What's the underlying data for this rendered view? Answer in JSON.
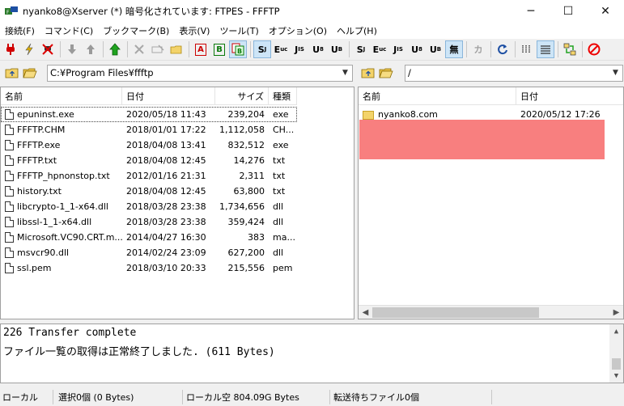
{
  "window": {
    "title": "nyanko8@Xserver (*) 暗号化されています: FTPES - FFFTP",
    "minimize": "─",
    "maximize": "☐",
    "close": "✕"
  },
  "menu": [
    {
      "label": "接続(F)"
    },
    {
      "label": "コマンド(C)"
    },
    {
      "label": "ブックマーク(B)"
    },
    {
      "label": "表示(V)"
    },
    {
      "label": "ツール(T)"
    },
    {
      "label": "オプション(O)"
    },
    {
      "label": "ヘルプ(H)"
    }
  ],
  "toolbar": {
    "connect_icon": "plug-connect-icon",
    "quick_connect_icon": "lightning-icon",
    "disconnect_icon": "plug-disconnect-icon",
    "download_icon": "arrow-down-icon",
    "upload_icon": "arrow-up-icon",
    "mirror_upload_icon": "green-up-arrow-icon",
    "delete_icon": "x-icon",
    "rename_icon": "rename-icon",
    "mkdir_icon": "new-folder-icon",
    "ascii_label": "A",
    "binary_label": "B",
    "auto_label": "",
    "kanji_sjis": "S",
    "kanji_euc": "E",
    "kanji_jis": "J",
    "kanji_utf8": "U",
    "kanji_utf8bom": "U",
    "kanji_none": "無",
    "kana_label": "カ",
    "refresh_icon": "refresh-icon",
    "list_icon": "list-view-icon",
    "details_icon": "details-view-icon",
    "sync_icon": "sync-folders-icon",
    "stop_icon": "stop-icon"
  },
  "local": {
    "path": "C:¥Program Files¥ffftp",
    "columns": [
      "名前",
      "日付",
      "サイズ",
      "種類"
    ],
    "files": [
      {
        "name": "epuninst.exe",
        "date": "2020/05/18 11:43",
        "size": "239,204",
        "type": "exe"
      },
      {
        "name": "FFFTP.CHM",
        "date": "2018/01/01 17:22",
        "size": "1,112,058",
        "type": "CH..."
      },
      {
        "name": "FFFTP.exe",
        "date": "2018/04/08 13:41",
        "size": "832,512",
        "type": "exe"
      },
      {
        "name": "FFFTP.txt",
        "date": "2018/04/08 12:45",
        "size": "14,276",
        "type": "txt"
      },
      {
        "name": "FFFTP_hpnonstop.txt",
        "date": "2012/01/16 21:31",
        "size": "2,311",
        "type": "txt"
      },
      {
        "name": "history.txt",
        "date": "2018/04/08 12:45",
        "size": "63,800",
        "type": "txt"
      },
      {
        "name": "libcrypto-1_1-x64.dll",
        "date": "2018/03/28 23:38",
        "size": "1,734,656",
        "type": "dll"
      },
      {
        "name": "libssl-1_1-x64.dll",
        "date": "2018/03/28 23:38",
        "size": "359,424",
        "type": "dll"
      },
      {
        "name": "Microsoft.VC90.CRT.m...",
        "date": "2014/04/27 16:30",
        "size": "383",
        "type": "ma..."
      },
      {
        "name": "msvcr90.dll",
        "date": "2014/02/24 23:09",
        "size": "627,200",
        "type": "dll"
      },
      {
        "name": "ssl.pem",
        "date": "2018/03/10 20:33",
        "size": "215,556",
        "type": "pem"
      }
    ]
  },
  "remote": {
    "path": "/",
    "columns": [
      "名前",
      "日付"
    ],
    "files": [
      {
        "name": "nyanko8.com",
        "date": "2020/05/12 17:26"
      }
    ]
  },
  "log": {
    "lines": [
      "226 Transfer complete",
      "ファイル一覧の取得は正常終了しました. (611 Bytes)"
    ]
  },
  "status": {
    "local_label": "ローカル",
    "selection": "選択0個 (0 Bytes)",
    "free_space": "ローカル空 804.09G Bytes",
    "queue": "転送待ちファイル0個"
  }
}
